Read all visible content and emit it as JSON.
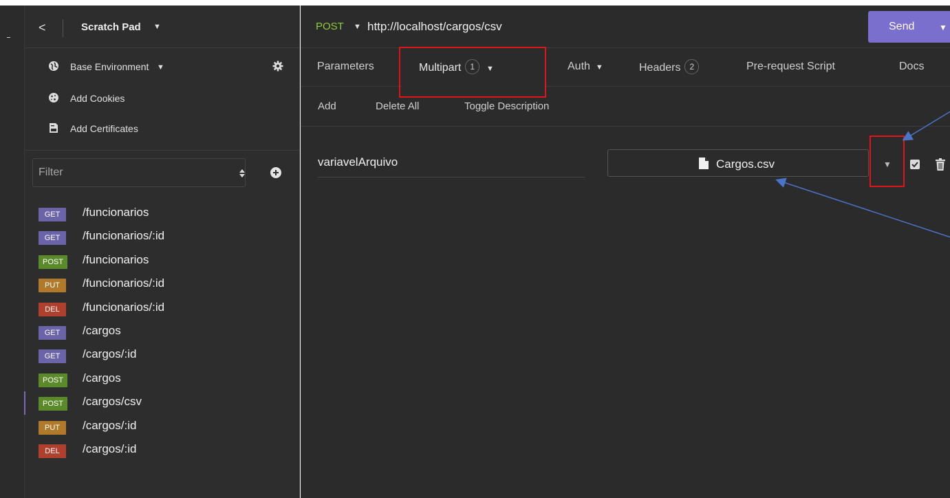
{
  "sidebar": {
    "back_label": "<",
    "workspace_title": "Scratch Pad",
    "menu": [
      {
        "label": "Base Environment",
        "icon": "globe-icon"
      },
      {
        "label": "Add Cookies",
        "icon": "cookie-icon"
      },
      {
        "label": "Add Certificates",
        "icon": "certificate-icon"
      }
    ],
    "filter_placeholder": "Filter",
    "requests": [
      {
        "method": "GET",
        "path": "/funcionarios",
        "color": "#6c64a8"
      },
      {
        "method": "GET",
        "path": "/funcionarios/:id",
        "color": "#6c64a8"
      },
      {
        "method": "POST",
        "path": "/funcionarios",
        "color": "#5a8a2a"
      },
      {
        "method": "PUT",
        "path": "/funcionarios/:id",
        "color": "#b07a2a"
      },
      {
        "method": "DEL",
        "path": "/funcionarios/:id",
        "color": "#b0402e"
      },
      {
        "method": "GET",
        "path": "/cargos",
        "color": "#6c64a8"
      },
      {
        "method": "GET",
        "path": "/cargos/:id",
        "color": "#6c64a8"
      },
      {
        "method": "POST",
        "path": "/cargos",
        "color": "#5a8a2a"
      },
      {
        "method": "POST",
        "path": "/cargos/csv",
        "color": "#5a8a2a",
        "active": true
      },
      {
        "method": "PUT",
        "path": "/cargos/:id",
        "color": "#b07a2a"
      },
      {
        "method": "DEL",
        "path": "/cargos/:id",
        "color": "#b0402e"
      }
    ]
  },
  "request": {
    "method": "POST",
    "url": "http://localhost/cargos/csv",
    "send_label": "Send"
  },
  "tabs": {
    "parameters": "Parameters",
    "multipart": "Multipart",
    "multipart_count": "1",
    "auth": "Auth",
    "headers": "Headers",
    "headers_count": "2",
    "pre_request": "Pre-request Script",
    "docs": "Docs"
  },
  "toolbar": {
    "add": "Add",
    "delete_all": "Delete All",
    "toggle_description": "Toggle Description"
  },
  "multipart_row": {
    "name": "variavelArquivo",
    "file_name": "Cargos.csv",
    "enabled": true
  },
  "colors": {
    "accent": "#7b6fce",
    "method_post": "#8fce3a",
    "annotation_red": "#e0151b",
    "annotation_arrow": "#4a74c9"
  }
}
